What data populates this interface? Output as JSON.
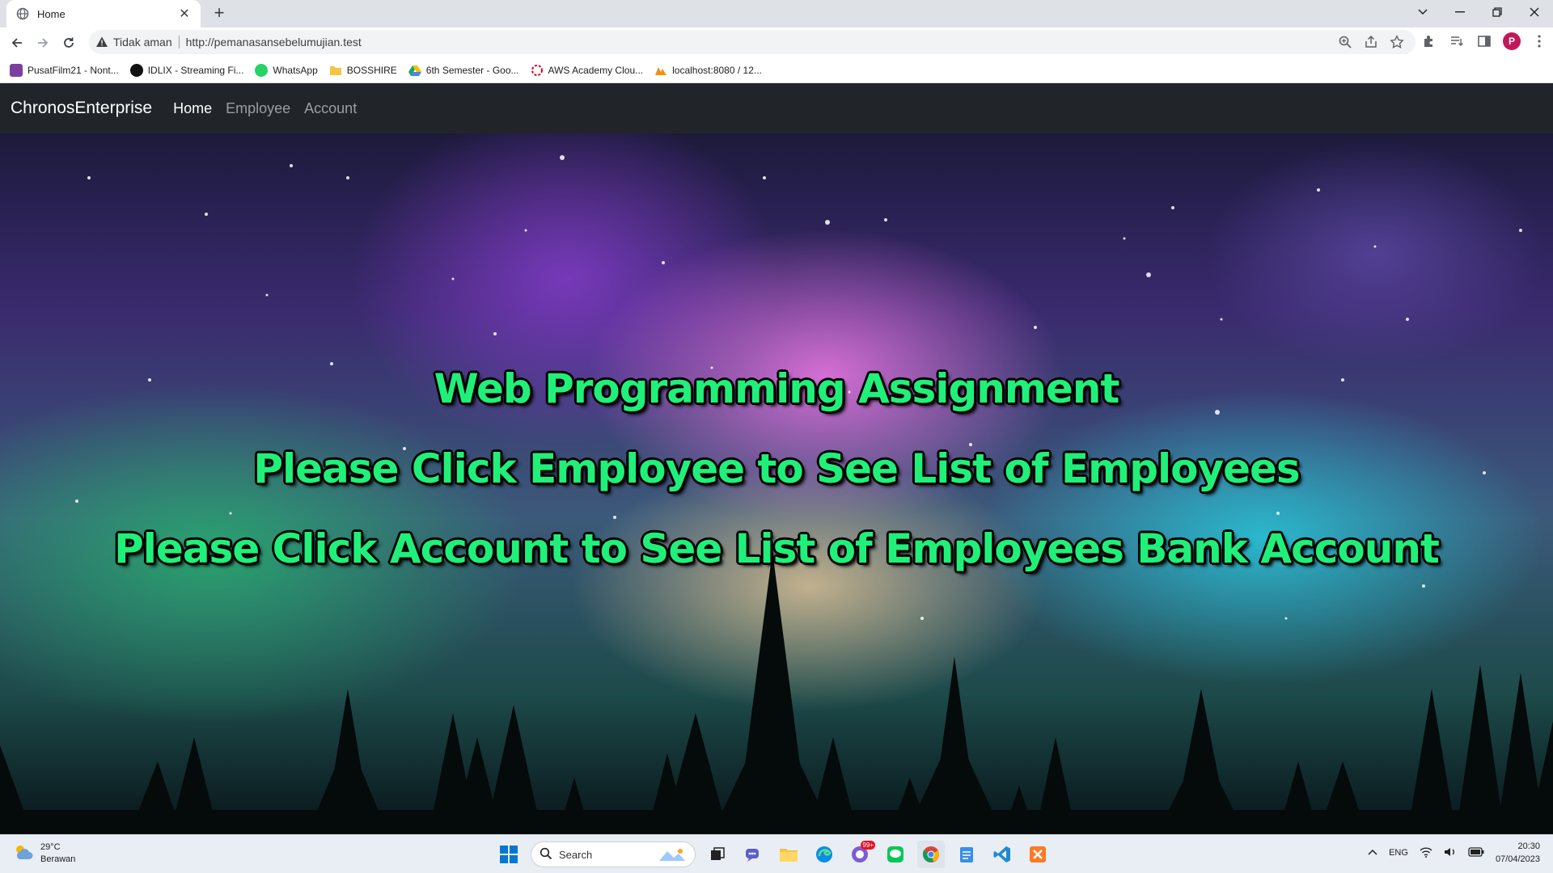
{
  "browser": {
    "tab_title": "Home",
    "security_label": "Tidak aman",
    "url": "http://pemanasansebelumujian.test",
    "bookmarks": [
      {
        "label": "PusatFilm21 - Nont...",
        "icon": "pusatfilm-icon",
        "color": "#7a3fa0"
      },
      {
        "label": "IDLIX - Streaming Fi...",
        "icon": "idlix-icon",
        "color": "#111111"
      },
      {
        "label": "WhatsApp",
        "icon": "whatsapp-icon",
        "color": "#25d366"
      },
      {
        "label": "BOSSHIRE",
        "icon": "folder-icon",
        "color": "#f4c542"
      },
      {
        "label": "6th Semester - Goo...",
        "icon": "google-drive-icon",
        "color": "#1fa463"
      },
      {
        "label": "AWS Academy Clou...",
        "icon": "aws-icon",
        "color": "#d0021b"
      },
      {
        "label": "localhost:8080 / 12...",
        "icon": "phpmyadmin-icon",
        "color": "#f29111"
      }
    ]
  },
  "navbar": {
    "brand": "ChronosEnterprise",
    "links": [
      "Home",
      "Employee",
      "Account"
    ],
    "active": "Home"
  },
  "hero": {
    "line1": "Web Programming Assignment",
    "line2": "Please Click Employee to See List of Employees",
    "line3": "Please Click Account to See List of Employees Bank Account",
    "text_color": "#20f07a"
  },
  "taskbar": {
    "temperature": "29°C",
    "weather": "Berawan",
    "search_label": "Search",
    "language": "ENG",
    "time": "20:30",
    "date": "07/04/2023",
    "notification_badge": "99+"
  }
}
